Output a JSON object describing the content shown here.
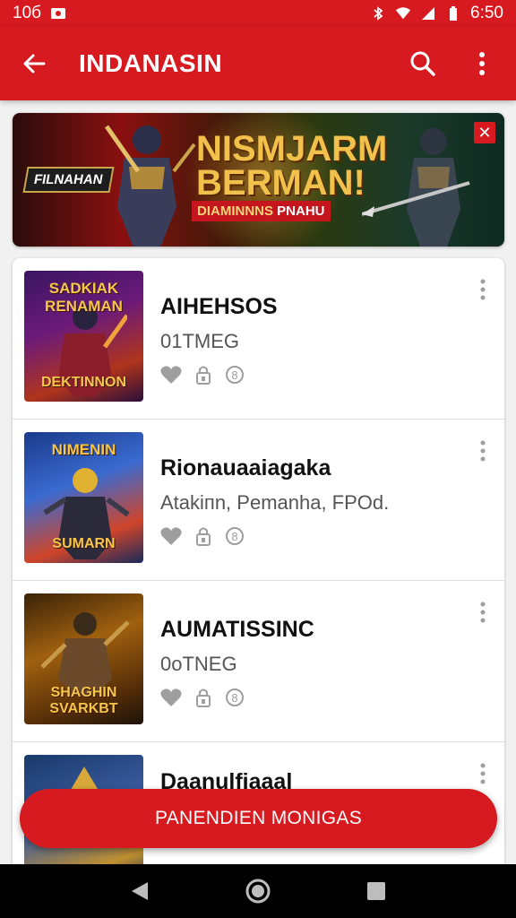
{
  "status_bar": {
    "left_text": "10б",
    "time": "6:50",
    "icons": [
      "photo-icon",
      "bluetooth-icon",
      "wifi-icon",
      "signal-icon",
      "battery-icon"
    ]
  },
  "app_bar": {
    "title": "INDANASIN",
    "icons": [
      "back-arrow-icon",
      "search-icon",
      "more-vert-icon"
    ]
  },
  "banner": {
    "tag": "FILNAHAN",
    "headline_1": "NISMJARM",
    "headline_2": "BERMAN!",
    "sub_a": "DIAMINNNS",
    "sub_b": "PNAHU",
    "close_icon": "close-icon",
    "accent": "#d71920"
  },
  "games": [
    {
      "thumb_top": "SADKIAK RENAMAN",
      "thumb_bottom": "DEKTINNON",
      "name": "AIHEHSOS",
      "meta": "01TMEG",
      "icons": [
        "heart-icon",
        "lock-icon",
        "rating-icon"
      ]
    },
    {
      "thumb_top": "NIMENIN",
      "thumb_bottom": "SUMARN",
      "name": "Rionauaaiagaka",
      "meta": "Atakiпn, Pemanha, FPOd.",
      "icons": [
        "heart-icon",
        "lock-icon",
        "rating-icon"
      ]
    },
    {
      "thumb_top": "",
      "thumb_bottom": "SHAGHIN SVARKBT",
      "name": "AUMATISSINC",
      "meta": "0oTNEG",
      "icons": [
        "heart-icon",
        "lock-icon",
        "rating-icon"
      ]
    },
    {
      "thumb_top": "",
      "thumb_bottom": "",
      "name": "Daanulfiaaal",
      "meta": "",
      "icons": []
    }
  ],
  "fab": {
    "label": "PANENDIEN MONIGAS"
  },
  "nav_bar": {
    "icons": [
      "nav-back-icon",
      "nav-home-icon",
      "nav-recents-icon"
    ]
  },
  "colors": {
    "primary": "#d71920",
    "background": "#f1f1f1"
  }
}
